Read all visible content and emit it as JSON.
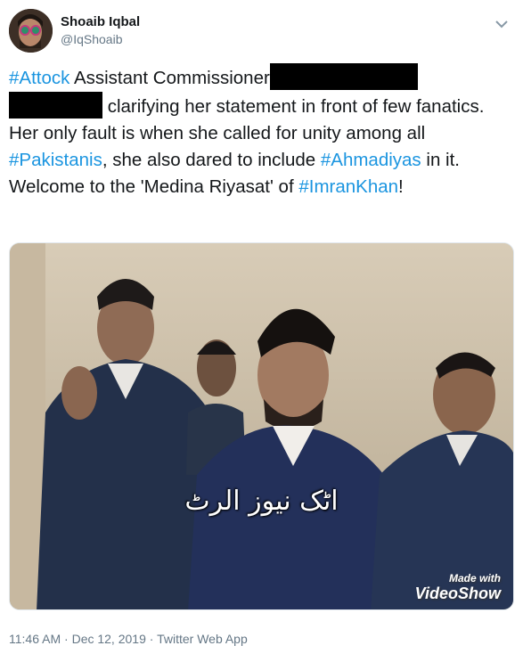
{
  "author": {
    "name": "Shoaib Iqbal",
    "handle": "@IqShoaib",
    "avatar_icon": "profile-avatar"
  },
  "menu_icon": "chevron-down-icon",
  "tweet": {
    "tag_attock": "#Attock",
    "text_1": " Assistant Commissioner",
    "text_2": " clarifying her statement in front of few fanatics. Her only fault is when she called for unity among all ",
    "tag_pakistanis": "#Pakistanis",
    "text_3": ", she also dared to include ",
    "tag_ahmadiyas": "#Ahmadiyas",
    "text_4": " in it. Welcome to the 'Medina Riyasat' of ",
    "tag_imrankhan": "#ImranKhan",
    "text_5": "!"
  },
  "media": {
    "caption_urdu": "اٹک نیوز الرٹ",
    "watermark_line1": "Made with",
    "watermark_line2": "VideoShow"
  },
  "meta": {
    "time": "11:46 AM",
    "separator": " · ",
    "date": "Dec 12, 2019",
    "source": "Twitter Web App"
  },
  "colors": {
    "hashtag": "#1b95e0",
    "muted": "#657786",
    "text": "#14171a"
  }
}
